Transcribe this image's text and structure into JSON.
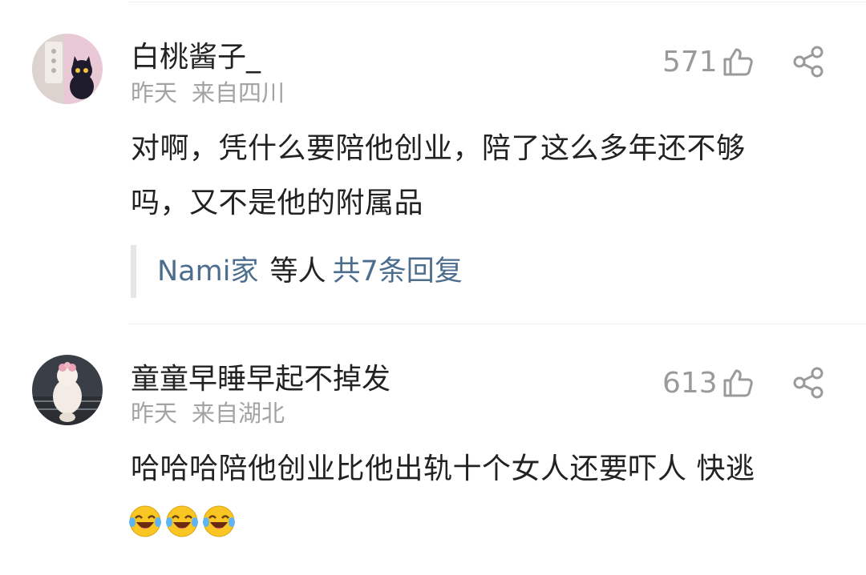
{
  "comments": [
    {
      "username": "白桃酱子_",
      "date": "昨天",
      "location": "来自四川",
      "likes": "571",
      "text_line1": "对啊，凭什么要陪他创业，陪了这么多年还不够",
      "text_line2": "吗，又不是他的附属品",
      "reply": {
        "names": "Nami家",
        "mid": "等人",
        "total": "共7条回复"
      }
    },
    {
      "username": "童童早睡早起不掉发",
      "date": "昨天",
      "location": "来自湖北",
      "likes": "613",
      "text_line1": "哈哈哈陪他创业比他出轨十个女人还要吓人 快逃",
      "emojis": [
        "laugh-cry-emoji",
        "laugh-cry-emoji",
        "laugh-cry-emoji"
      ]
    }
  ],
  "icons": {
    "like": "thumbs-up-icon",
    "share": "share-icon"
  },
  "colors": {
    "link": "#4c6e8e",
    "meta": "#a3a3a3",
    "text": "#222222"
  }
}
